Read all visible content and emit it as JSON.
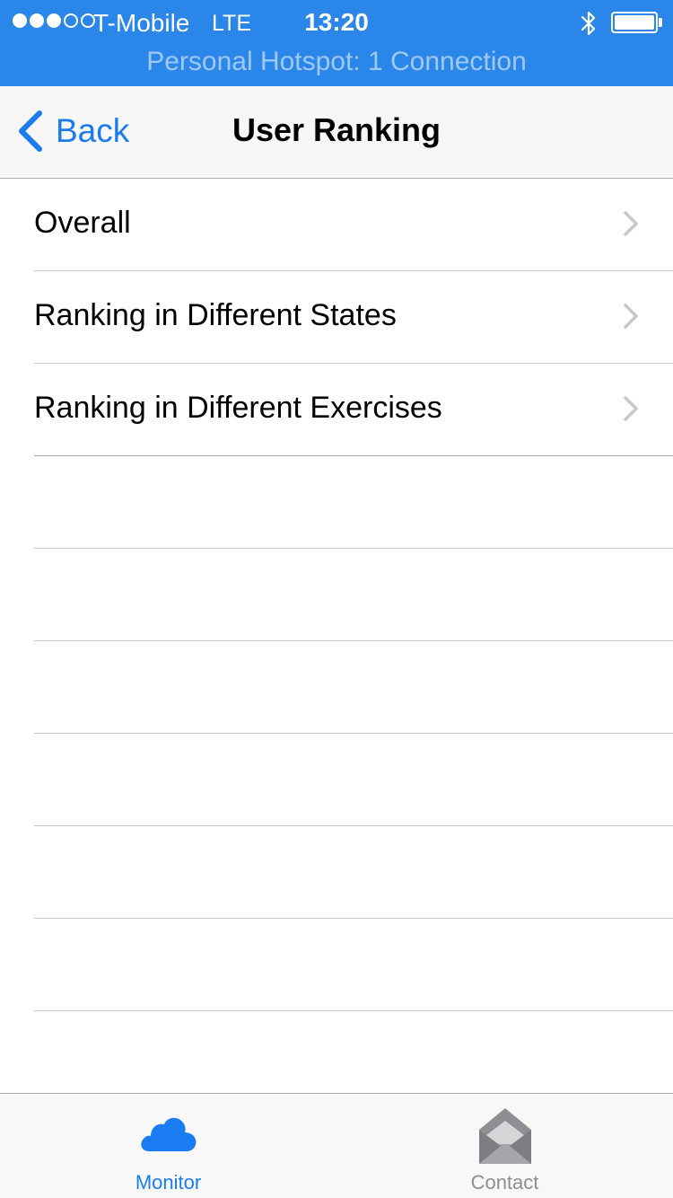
{
  "status_bar": {
    "carrier": "T-Mobile",
    "network": "LTE",
    "time": "13:20",
    "hotspot": "Personal Hotspot: 1 Connection",
    "signal_strength": 3,
    "signal_max": 5,
    "battery_level": 1.0,
    "icons": [
      "bluetooth-icon",
      "battery-icon"
    ]
  },
  "nav": {
    "back_label": "Back",
    "title": "User Ranking",
    "back_icon": "chevron-left-icon"
  },
  "rows": [
    {
      "label": "Overall"
    },
    {
      "label": "Ranking in Different States"
    },
    {
      "label": "Ranking in Different Exercises"
    }
  ],
  "tabs": {
    "monitor": {
      "label": "Monitor",
      "icon": "cloud-icon",
      "selected": true
    },
    "contact": {
      "label": "Contact",
      "icon": "envelope-icon",
      "selected": false
    }
  },
  "colors": {
    "status_bar_bg": "#2a86e8",
    "accent": "#1a7cf0",
    "inactive_tab": "#8e8e93"
  }
}
